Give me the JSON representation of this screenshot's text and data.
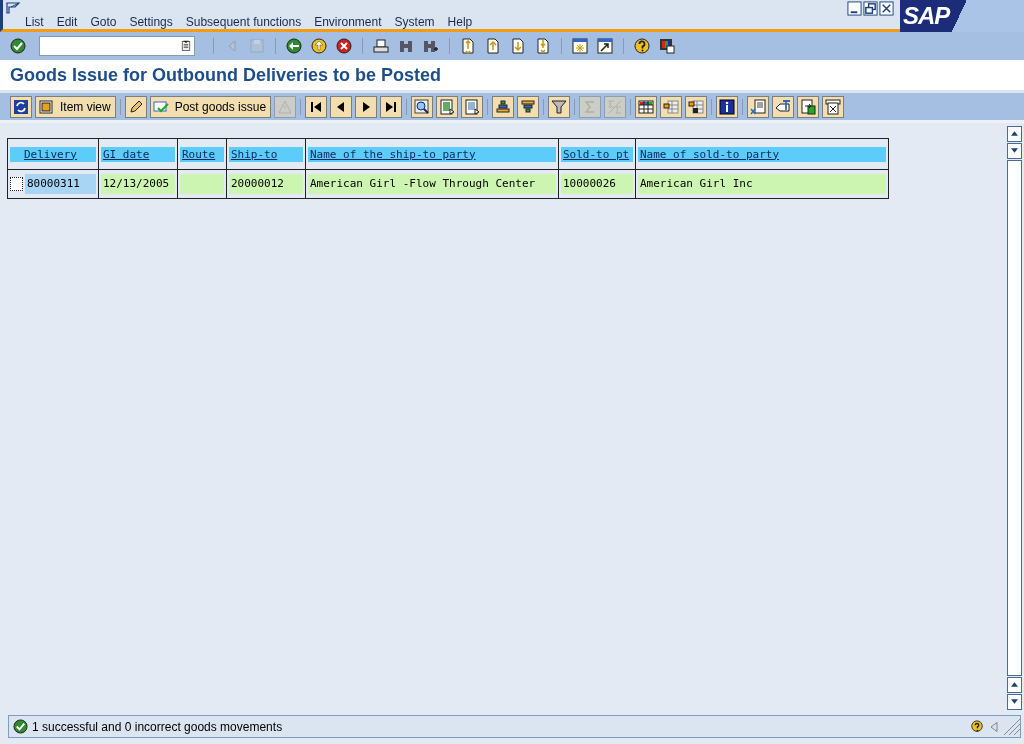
{
  "menu": [
    {
      "label": "List"
    },
    {
      "label": "Edit"
    },
    {
      "label": "Goto"
    },
    {
      "label": "Settings"
    },
    {
      "label": "Subsequent functions"
    },
    {
      "label": "Environment"
    },
    {
      "label": "System"
    },
    {
      "label": "Help"
    }
  ],
  "logo": {
    "text": "SAP"
  },
  "standard_toolbar": {
    "groups": [
      [
        {
          "disabled": false
        }
      ],
      [
        {
          "disabled": true
        },
        {
          "disabled": true
        }
      ],
      [
        {
          "disabled": false
        },
        {
          "disabled": false
        },
        {
          "disabled": false
        }
      ],
      [
        {
          "disabled": false
        },
        {
          "disabled": false
        },
        {
          "disabled": false
        }
      ],
      [
        {
          "disabled": false
        },
        {
          "disabled": false
        },
        {
          "disabled": false
        },
        {
          "disabled": false
        }
      ],
      [
        {
          "disabled": false
        },
        {
          "disabled": false
        }
      ],
      [
        {
          "disabled": false
        },
        {
          "disabled": false
        }
      ]
    ]
  },
  "title": "Goods Issue for Outbound Deliveries to be Posted",
  "application_toolbar": {
    "groups": [
      [
        {
          "disabled": false
        },
        {
          "label": "Item view",
          "disabled": false
        }
      ],
      [
        {
          "disabled": false
        },
        {
          "label": "Post goods issue",
          "disabled": false
        },
        {
          "disabled": true
        }
      ],
      [
        {
          "disabled": false
        },
        {
          "disabled": false
        },
        {
          "disabled": false
        },
        {
          "disabled": false
        }
      ],
      [
        {
          "disabled": false
        },
        {
          "disabled": false
        },
        {
          "disabled": false
        }
      ],
      [
        {
          "disabled": false
        },
        {
          "disabled": false
        }
      ],
      [
        {
          "disabled": false
        }
      ],
      [
        {
          "disabled": true
        },
        {
          "disabled": true
        }
      ],
      [
        {
          "disabled": false
        },
        {
          "disabled": false
        },
        {
          "disabled": false
        }
      ],
      [
        {
          "disabled": false
        }
      ],
      [
        {
          "disabled": false
        },
        {
          "disabled": false
        },
        {
          "disabled": false
        },
        {
          "disabled": false
        }
      ]
    ]
  },
  "table": {
    "columns": [
      {
        "label": "Delivery",
        "key_field": true
      },
      {
        "label": "GI date",
        "key_field": false
      },
      {
        "label": "Route",
        "key_field": false
      },
      {
        "label": "Ship-to",
        "key_field": false
      },
      {
        "label": "Name of the ship-to party",
        "key_field": false
      },
      {
        "label": "Sold-to pt",
        "key_field": false
      },
      {
        "label": "Name of sold-to party",
        "key_field": false
      }
    ],
    "rows": [
      {
        "checked": false,
        "cells": [
          "80000311",
          "12/13/2005",
          null,
          "20000012",
          "American Girl -Flow Through Center",
          "10000026",
          "American Girl Inc"
        ]
      }
    ]
  },
  "status_bar": {
    "kind": "success",
    "message": "1 successful and 0 incorrect goods movements"
  }
}
